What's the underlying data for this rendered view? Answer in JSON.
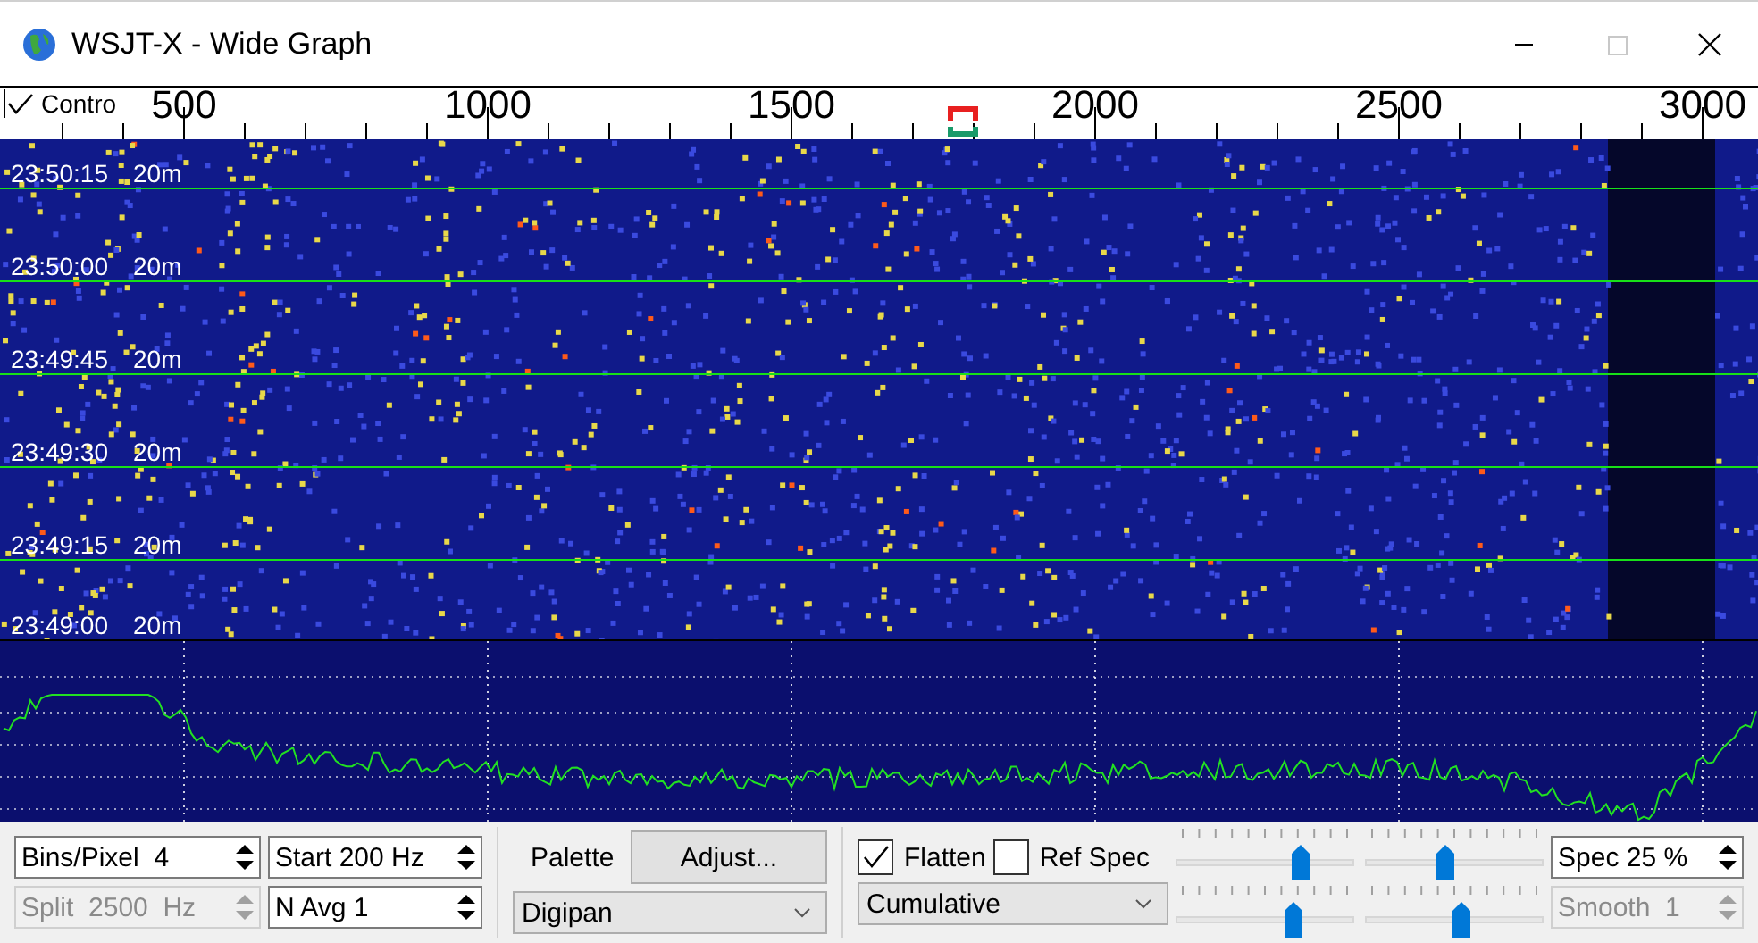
{
  "window": {
    "title": "WSJT-X - Wide Graph"
  },
  "control_toggle": {
    "label": "Contro",
    "checked": true
  },
  "scale": {
    "labels": [
      "500",
      "1000",
      "1500",
      "2000",
      "2500",
      "3000"
    ]
  },
  "waterfall": {
    "rows": [
      {
        "time": "23:50:15",
        "band": "20m"
      },
      {
        "time": "23:50:00",
        "band": "20m"
      },
      {
        "time": "23:49:45",
        "band": "20m"
      },
      {
        "time": "23:49:30",
        "band": "20m"
      },
      {
        "time": "23:49:15",
        "band": "20m"
      },
      {
        "time": "23:49:00",
        "band": "20m"
      }
    ]
  },
  "controls": {
    "bins_per_pixel": {
      "text": "Bins/Pixel  4",
      "disabled": false
    },
    "start": {
      "text": "Start 200 Hz",
      "disabled": false
    },
    "split": {
      "text": "Split  2500  Hz",
      "disabled": true
    },
    "n_avg": {
      "text": "N Avg 1",
      "disabled": false
    },
    "palette_label": "Palette",
    "adjust_button": "Adjust...",
    "palette_dropdown": "Digipan",
    "flatten": {
      "label": "Flatten",
      "checked": true
    },
    "ref_spec": {
      "label": "Ref Spec",
      "checked": false
    },
    "spectrum_dropdown": "Cumulative",
    "sliders": [
      {
        "level": 0.7
      },
      {
        "level": 0.45
      },
      {
        "level": 0.66
      },
      {
        "level": 0.54
      }
    ],
    "spec": {
      "text": "Spec 25 %",
      "disabled": false
    },
    "smooth": {
      "text": "Smooth  1",
      "disabled": true
    }
  }
}
